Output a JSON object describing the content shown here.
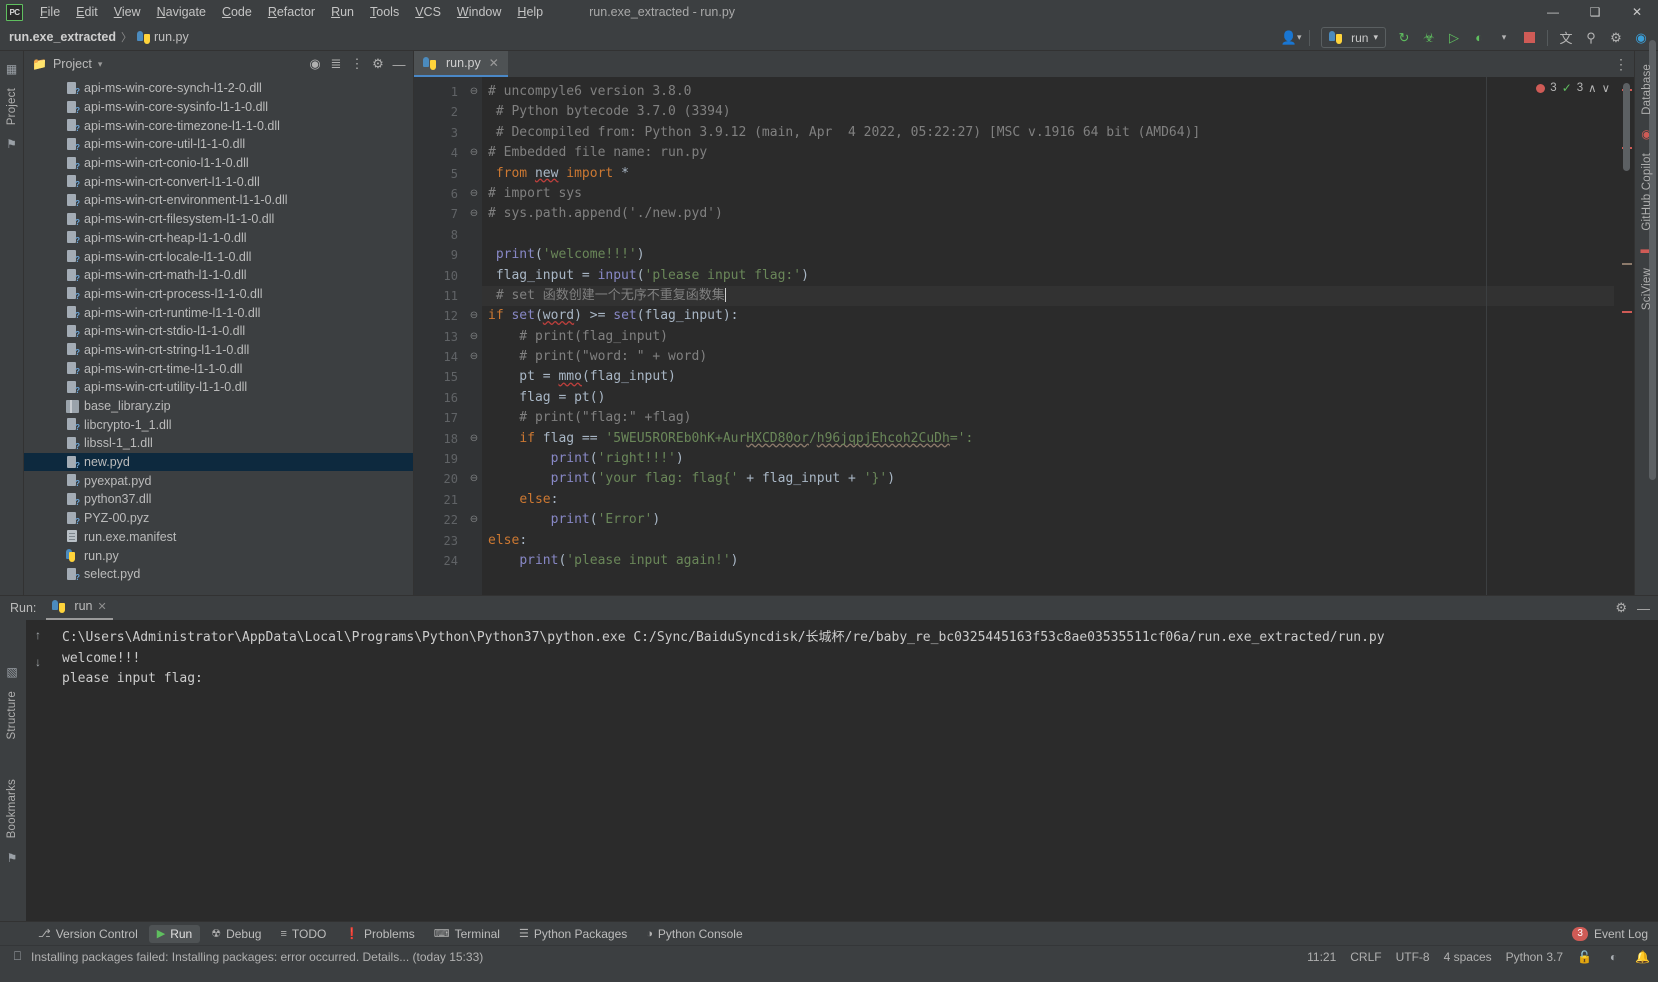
{
  "window": {
    "title": "run.exe_extracted - run.py",
    "logo_text": "PC",
    "minimize": "—",
    "maximize": "❑",
    "close": "✕"
  },
  "menubar": {
    "items": [
      "File",
      "Edit",
      "View",
      "Navigate",
      "Code",
      "Refactor",
      "Run",
      "Tools",
      "VCS",
      "Window",
      "Help"
    ]
  },
  "breadcrumb": {
    "root": "run.exe_extracted",
    "separator": "〉",
    "file": "run.py"
  },
  "toolbar": {
    "user_icon": "user-icon",
    "run_config": "run",
    "dropdown_caret": "▾",
    "buttons": [
      {
        "name": "rerun-icon",
        "glyph": "↻"
      },
      {
        "name": "debug-icon",
        "glyph": "☢"
      },
      {
        "name": "coverage-icon",
        "glyph": "▷"
      },
      {
        "name": "profile-icon",
        "glyph": "◔"
      },
      {
        "name": "stop-icon",
        "glyph": "■"
      },
      {
        "name": "translate-icon",
        "glyph": "文"
      },
      {
        "name": "search-everywhere-icon",
        "glyph": "⌕"
      },
      {
        "name": "settings-gear-icon",
        "glyph": "⚙"
      },
      {
        "name": "updates-icon",
        "glyph": "◕"
      }
    ]
  },
  "left_rail": {
    "items": [
      "Project",
      "Structure",
      "Bookmarks"
    ]
  },
  "right_rail": {
    "items": [
      "Database",
      "GitHub Copilot",
      "SciView"
    ]
  },
  "project_panel": {
    "title": "Project",
    "caret": "▾",
    "header_icons": [
      "locate-icon",
      "collapse-all-icon",
      "expand-icon",
      "settings-icon",
      "hide-icon"
    ],
    "tree": [
      {
        "label": "api-ms-win-core-synch-l1-2-0.dll",
        "icon": "dll",
        "selected": false
      },
      {
        "label": "api-ms-win-core-sysinfo-l1-1-0.dll",
        "icon": "dll",
        "selected": false
      },
      {
        "label": "api-ms-win-core-timezone-l1-1-0.dll",
        "icon": "dll",
        "selected": false
      },
      {
        "label": "api-ms-win-core-util-l1-1-0.dll",
        "icon": "dll",
        "selected": false
      },
      {
        "label": "api-ms-win-crt-conio-l1-1-0.dll",
        "icon": "dll",
        "selected": false
      },
      {
        "label": "api-ms-win-crt-convert-l1-1-0.dll",
        "icon": "dll",
        "selected": false
      },
      {
        "label": "api-ms-win-crt-environment-l1-1-0.dll",
        "icon": "dll",
        "selected": false
      },
      {
        "label": "api-ms-win-crt-filesystem-l1-1-0.dll",
        "icon": "dll",
        "selected": false
      },
      {
        "label": "api-ms-win-crt-heap-l1-1-0.dll",
        "icon": "dll",
        "selected": false
      },
      {
        "label": "api-ms-win-crt-locale-l1-1-0.dll",
        "icon": "dll",
        "selected": false
      },
      {
        "label": "api-ms-win-crt-math-l1-1-0.dll",
        "icon": "dll",
        "selected": false
      },
      {
        "label": "api-ms-win-crt-process-l1-1-0.dll",
        "icon": "dll",
        "selected": false
      },
      {
        "label": "api-ms-win-crt-runtime-l1-1-0.dll",
        "icon": "dll",
        "selected": false
      },
      {
        "label": "api-ms-win-crt-stdio-l1-1-0.dll",
        "icon": "dll",
        "selected": false
      },
      {
        "label": "api-ms-win-crt-string-l1-1-0.dll",
        "icon": "dll",
        "selected": false
      },
      {
        "label": "api-ms-win-crt-time-l1-1-0.dll",
        "icon": "dll",
        "selected": false
      },
      {
        "label": "api-ms-win-crt-utility-l1-1-0.dll",
        "icon": "dll",
        "selected": false
      },
      {
        "label": "base_library.zip",
        "icon": "zip",
        "selected": false
      },
      {
        "label": "libcrypto-1_1.dll",
        "icon": "dll",
        "selected": false
      },
      {
        "label": "libssl-1_1.dll",
        "icon": "dll",
        "selected": false
      },
      {
        "label": "new.pyd",
        "icon": "dll",
        "selected": true
      },
      {
        "label": "pyexpat.pyd",
        "icon": "dll",
        "selected": false
      },
      {
        "label": "python37.dll",
        "icon": "dll",
        "selected": false
      },
      {
        "label": "PYZ-00.pyz",
        "icon": "dll",
        "selected": false
      },
      {
        "label": "run.exe.manifest",
        "icon": "manifest",
        "selected": false
      },
      {
        "label": "run.py",
        "icon": "py",
        "selected": false
      },
      {
        "label": "select.pyd",
        "icon": "dll",
        "selected": false
      }
    ]
  },
  "editor": {
    "tab": {
      "label": "run.py",
      "close": "✕"
    },
    "inspections": {
      "error_count": "3",
      "warning_count": "3",
      "up": "∧",
      "down": "∨"
    },
    "options_icon": "⋮",
    "lines": [
      {
        "n": "1",
        "fold": "⊖",
        "tokens": [
          {
            "t": "# uncompyle6 version 3.8.0",
            "c": "cmt"
          }
        ]
      },
      {
        "n": "2",
        "fold": "",
        "tokens": [
          {
            "t": " # Python bytecode 3.7.0 (3394)",
            "c": "cmt"
          }
        ]
      },
      {
        "n": "3",
        "fold": "",
        "tokens": [
          {
            "t": " # Decompiled from: Python 3.9.12 (main, Apr  4 2022, 05:22:27) [MSC v.1916 64 bit (AMD64)]",
            "c": "cmt"
          }
        ]
      },
      {
        "n": "4",
        "fold": "⊖",
        "tokens": [
          {
            "t": "# Embedded file name: run.py",
            "c": "cmt"
          }
        ]
      },
      {
        "n": "5",
        "fold": "",
        "tokens": [
          {
            "t": " ",
            "c": ""
          },
          {
            "t": "from",
            "c": "kw"
          },
          {
            "t": " ",
            "c": ""
          },
          {
            "t": "new",
            "c": "ident wavyred"
          },
          {
            "t": " ",
            "c": ""
          },
          {
            "t": "import",
            "c": "kw"
          },
          {
            "t": " *",
            "c": "ident"
          }
        ]
      },
      {
        "n": "6",
        "fold": "⊖",
        "tokens": [
          {
            "t": "# import sys",
            "c": "cmt"
          }
        ]
      },
      {
        "n": "7",
        "fold": "⊖",
        "tokens": [
          {
            "t": "# sys.path.append('./new.pyd')",
            "c": "cmt"
          }
        ]
      },
      {
        "n": "8",
        "fold": "",
        "tokens": [
          {
            "t": "",
            "c": ""
          }
        ]
      },
      {
        "n": "9",
        "fold": "",
        "tokens": [
          {
            "t": " ",
            "c": ""
          },
          {
            "t": "print",
            "c": "bfn"
          },
          {
            "t": "(",
            "c": "ident"
          },
          {
            "t": "'welcome!!!'",
            "c": "str"
          },
          {
            "t": ")",
            "c": "ident"
          }
        ]
      },
      {
        "n": "10",
        "fold": "",
        "tokens": [
          {
            "t": " flag_input = ",
            "c": "ident"
          },
          {
            "t": "input",
            "c": "bfn"
          },
          {
            "t": "(",
            "c": "ident"
          },
          {
            "t": "'please input flag:'",
            "c": "str"
          },
          {
            "t": ")",
            "c": "ident"
          }
        ]
      },
      {
        "n": "11",
        "fold": "",
        "current": true,
        "tokens": [
          {
            "t": " # set 函数创建一个无序不重复函数集",
            "c": "cmt"
          }
        ],
        "caret": true
      },
      {
        "n": "12",
        "fold": "⊖",
        "tokens": [
          {
            "t": "if",
            "c": "kw"
          },
          {
            "t": " ",
            "c": ""
          },
          {
            "t": "set",
            "c": "bfn"
          },
          {
            "t": "(",
            "c": "ident"
          },
          {
            "t": "word",
            "c": "ident wavyred"
          },
          {
            "t": ") >= ",
            "c": "ident"
          },
          {
            "t": "set",
            "c": "bfn"
          },
          {
            "t": "(flag_input):",
            "c": "ident"
          }
        ]
      },
      {
        "n": "13",
        "fold": "⊖",
        "tokens": [
          {
            "t": "    # print(flag_input)",
            "c": "cmt"
          }
        ]
      },
      {
        "n": "14",
        "fold": "⊖",
        "tokens": [
          {
            "t": "    # print(\"word: \" + word)",
            "c": "cmt"
          }
        ]
      },
      {
        "n": "15",
        "fold": "",
        "tokens": [
          {
            "t": "    pt = ",
            "c": "ident"
          },
          {
            "t": "mmo",
            "c": "ident wavyred"
          },
          {
            "t": "(flag_input)",
            "c": "ident"
          }
        ]
      },
      {
        "n": "16",
        "fold": "",
        "tokens": [
          {
            "t": "    flag = pt()",
            "c": "ident"
          }
        ]
      },
      {
        "n": "17",
        "fold": "",
        "tokens": [
          {
            "t": "    # print(\"flag:\" +flag)",
            "c": "cmt"
          }
        ]
      },
      {
        "n": "18",
        "fold": "⊖",
        "tokens": [
          {
            "t": "    ",
            "c": ""
          },
          {
            "t": "if",
            "c": "kw"
          },
          {
            "t": " flag == ",
            "c": "ident"
          },
          {
            "t": "'5WEU5ROREb0hK+Aur",
            "c": "str"
          },
          {
            "t": "HXCD80or",
            "c": "str wavy"
          },
          {
            "t": "/",
            "c": "str"
          },
          {
            "t": "h96jqpjEhcoh2CuDh",
            "c": "str wavy"
          },
          {
            "t": "=':",
            "c": "str"
          }
        ]
      },
      {
        "n": "19",
        "fold": "",
        "tokens": [
          {
            "t": "        ",
            "c": ""
          },
          {
            "t": "print",
            "c": "bfn"
          },
          {
            "t": "(",
            "c": "ident"
          },
          {
            "t": "'right!!!'",
            "c": "str"
          },
          {
            "t": ")",
            "c": "ident"
          }
        ]
      },
      {
        "n": "20",
        "fold": "⊖",
        "tokens": [
          {
            "t": "        ",
            "c": ""
          },
          {
            "t": "print",
            "c": "bfn"
          },
          {
            "t": "(",
            "c": "ident"
          },
          {
            "t": "'your flag: flag{'",
            "c": "str"
          },
          {
            "t": " + flag_input + ",
            "c": "ident"
          },
          {
            "t": "'}'",
            "c": "str"
          },
          {
            "t": ")",
            "c": "ident"
          }
        ]
      },
      {
        "n": "21",
        "fold": "",
        "tokens": [
          {
            "t": "    ",
            "c": ""
          },
          {
            "t": "else",
            "c": "kw"
          },
          {
            "t": ":",
            "c": "ident"
          }
        ]
      },
      {
        "n": "22",
        "fold": "⊖",
        "tokens": [
          {
            "t": "        ",
            "c": ""
          },
          {
            "t": "print",
            "c": "bfn"
          },
          {
            "t": "(",
            "c": "ident"
          },
          {
            "t": "'Error'",
            "c": "str"
          },
          {
            "t": ")",
            "c": "ident"
          }
        ]
      },
      {
        "n": "23",
        "fold": "",
        "tokens": [
          {
            "t": "else",
            "c": "kw"
          },
          {
            "t": ":",
            "c": "ident"
          }
        ]
      },
      {
        "n": "24",
        "fold": "",
        "tokens": [
          {
            "t": "    ",
            "c": ""
          },
          {
            "t": "print",
            "c": "bfn"
          },
          {
            "t": "(",
            "c": "ident"
          },
          {
            "t": "'please input again!'",
            "c": "str"
          },
          {
            "t": ")",
            "c": "ident"
          }
        ]
      }
    ]
  },
  "run_panel": {
    "label": "Run:",
    "tab_label": "run",
    "tab_close": "✕",
    "settings_icon": "⚙",
    "hide_icon": "—",
    "tool_icons": [
      "rerun-icon",
      "scroll-up-icon",
      "scroll-down-icon",
      "soft-wrap-icon",
      "print-icon",
      "clear-icon",
      "stop-icon"
    ],
    "console_lines": [
      "C:\\Users\\Administrator\\AppData\\Local\\Programs\\Python\\Python37\\python.exe C:/Sync/BaiduSyncdisk/长城杯/re/baby_re_bc0325445163f53c8ae03535511cf06a/run.exe_extracted/run.py",
      "welcome!!!",
      "please input flag:"
    ]
  },
  "toolwindow_bar": {
    "items": [
      {
        "label": "Version Control",
        "icon": "⎇",
        "active": false
      },
      {
        "label": "Run",
        "icon": "▶",
        "active": true
      },
      {
        "label": "Debug",
        "icon": "☢",
        "active": false
      },
      {
        "label": "TODO",
        "icon": "≡",
        "active": false
      },
      {
        "label": "Problems",
        "icon": "❗",
        "active": false
      },
      {
        "label": "Terminal",
        "icon": "⌨",
        "active": false
      },
      {
        "label": "Python Packages",
        "icon": "☰",
        "active": false
      },
      {
        "label": "Python Console",
        "icon": "◑",
        "active": false
      }
    ],
    "event_log": {
      "label": "Event Log",
      "count": "3"
    }
  },
  "statusbar": {
    "message": "Installing packages failed: Installing packages: error occurred. Details... (today 15:33)",
    "message_icon": "⎕",
    "caret_position": "11:21",
    "line_separator": "CRLF",
    "encoding": "UTF-8",
    "indent": "4 spaces",
    "interpreter": "Python 3.7",
    "right_icons": [
      "lock-icon",
      "inspection-icon",
      "notifications-icon"
    ]
  },
  "colors": {
    "accent": "#4a88c7",
    "selection": "#0d293e",
    "error": "#cf5b56",
    "ok": "#5fbf5f",
    "bg_chrome": "#3c3f41",
    "bg_editor": "#2b2b2b"
  }
}
